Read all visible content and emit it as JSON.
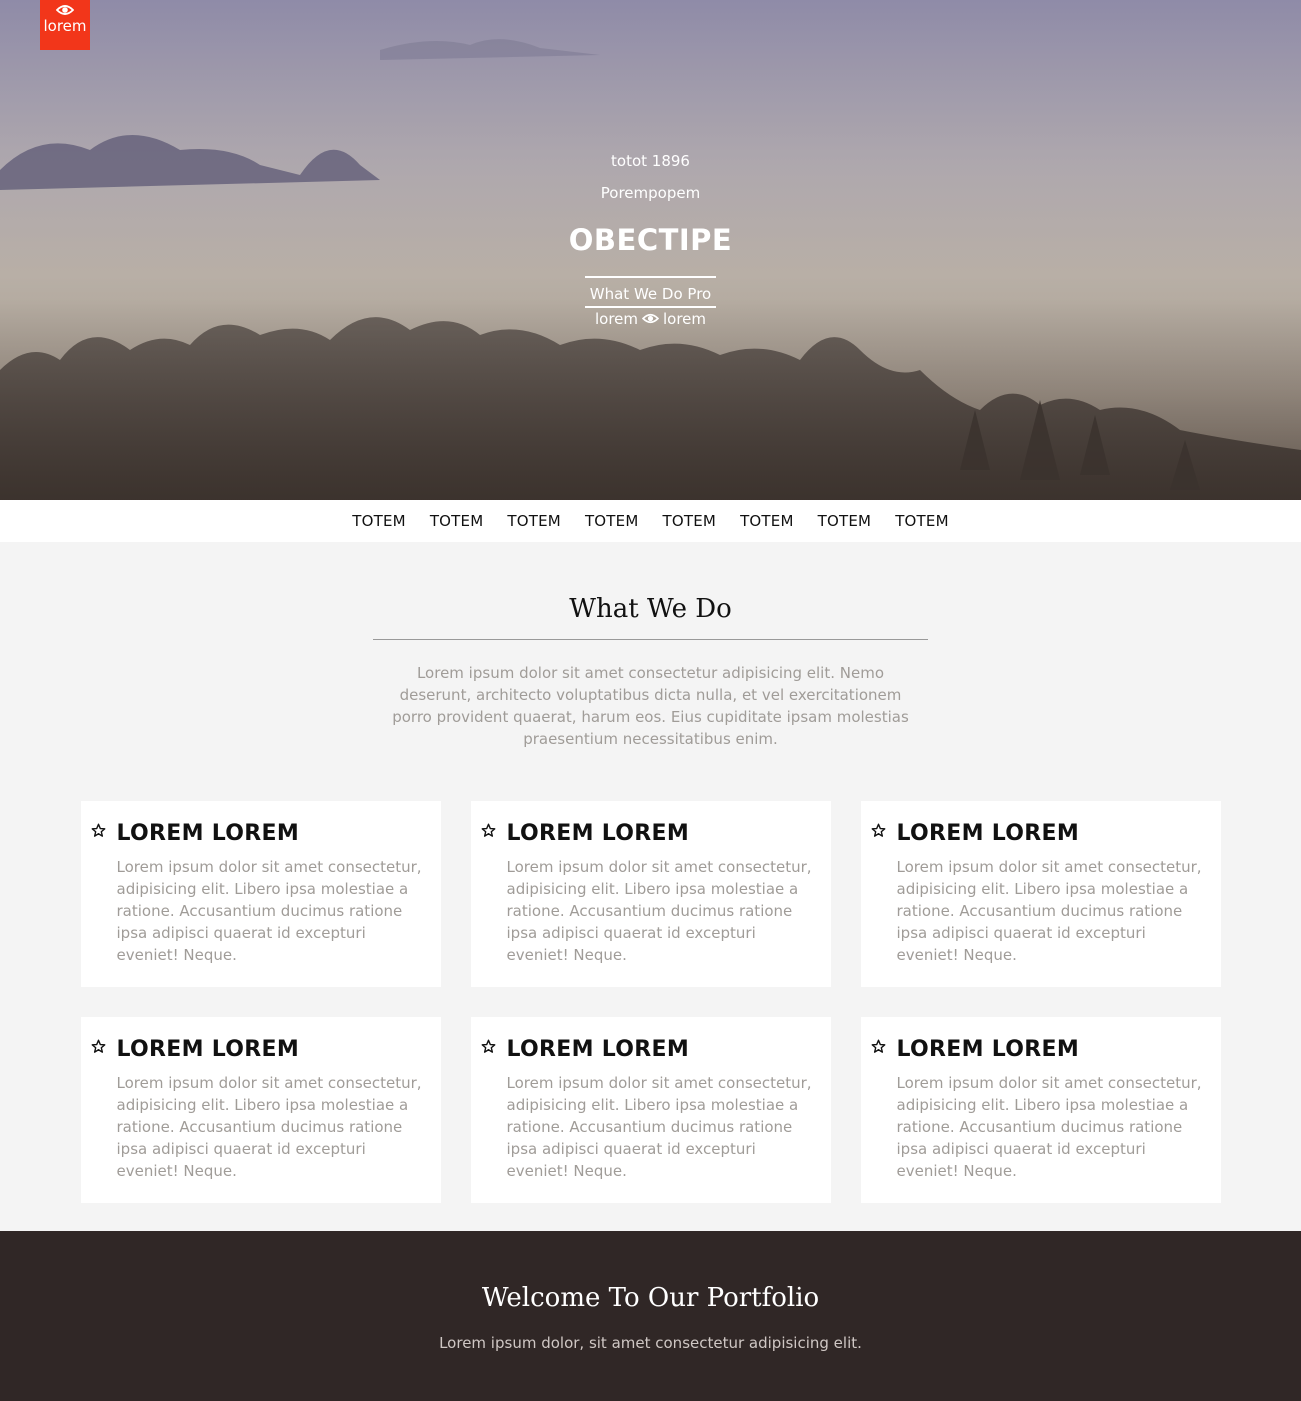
{
  "brand": {
    "logo_label": "lorem",
    "logo_icon": "eye-icon",
    "accent_color": "#f2361a"
  },
  "hero": {
    "line1": "totot 1896",
    "line2": "Porempopem",
    "title": "OBECTIPE",
    "cta_label": "What We Do Pro",
    "sub_left": "lorem",
    "sub_right": "lorem",
    "sub_icon": "eye-icon"
  },
  "nav": {
    "items": [
      "TOTEM",
      "TOTEM",
      "TOTEM",
      "TOTEM",
      "TOTEM",
      "TOTEM",
      "TOTEM",
      "TOTEM"
    ]
  },
  "what_we_do": {
    "title": "What We Do",
    "description": "Lorem ipsum dolor sit amet consectetur adipisicing elit. Nemo deserunt, architecto voluptatibus dicta nulla, et vel exercitationem porro provident quaerat, harum eos. Eius cupiditate ipsam molestias praesentium necessitatibus enim.",
    "cards": [
      {
        "icon": "star-icon",
        "title": "LOREM LOREM",
        "text": "Lorem ipsum dolor sit amet consectetur, adipisicing elit. Libero ipsa molestiae a ratione. Accusantium ducimus ratione ipsa adipisci quaerat id excepturi eveniet! Neque."
      },
      {
        "icon": "star-icon",
        "title": "LOREM LOREM",
        "text": "Lorem ipsum dolor sit amet consectetur, adipisicing elit. Libero ipsa molestiae a ratione. Accusantium ducimus ratione ipsa adipisci quaerat id excepturi eveniet! Neque."
      },
      {
        "icon": "star-icon",
        "title": "LOREM LOREM",
        "text": "Lorem ipsum dolor sit amet consectetur, adipisicing elit. Libero ipsa molestiae a ratione. Accusantium ducimus ratione ipsa adipisci quaerat id excepturi eveniet! Neque."
      },
      {
        "icon": "star-icon",
        "title": "LOREM LOREM",
        "text": "Lorem ipsum dolor sit amet consectetur, adipisicing elit. Libero ipsa molestiae a ratione. Accusantium ducimus ratione ipsa adipisci quaerat id excepturi eveniet! Neque."
      },
      {
        "icon": "star-icon",
        "title": "LOREM LOREM",
        "text": "Lorem ipsum dolor sit amet consectetur, adipisicing elit. Libero ipsa molestiae a ratione. Accusantium ducimus ratione ipsa adipisci quaerat id excepturi eveniet! Neque."
      },
      {
        "icon": "star-icon",
        "title": "LOREM LOREM",
        "text": "Lorem ipsum dolor sit amet consectetur, adipisicing elit. Libero ipsa molestiae a ratione. Accusantium ducimus ratione ipsa adipisci quaerat id excepturi eveniet! Neque."
      }
    ]
  },
  "portfolio": {
    "title": "Welcome To Our Portfolio",
    "subtitle": "Lorem ipsum dolor, sit amet consectetur adipisicing elit.",
    "background_color": "#302726"
  }
}
